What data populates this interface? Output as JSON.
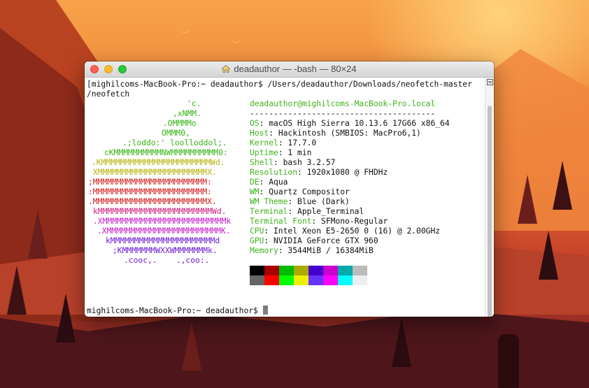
{
  "window": {
    "title": "deadauthor — -bash — 80×24"
  },
  "terminal": {
    "command_line_1": "[mighilcoms-MacBook-Pro:~ deadauthor$ /Users/deadauthor/Downloads/neofetch-master",
    "command_line_2": "/neofetch",
    "logo": [
      {
        "text": "'c.",
        "color": "#34b416"
      },
      {
        "text": ",xNMM.",
        "color": "#34b416"
      },
      {
        "text": ".OMMMMo",
        "color": "#34b416"
      },
      {
        "text": "OMMM0,",
        "color": "#34b416"
      },
      {
        "text": ".;loddo:' loolloddol;.",
        "color": "#34b416"
      },
      {
        "text": "cKMMMMMMMMMMNWMMMMMMMMMM0:",
        "color": "#34b416"
      },
      {
        "text": ".KMMMMMMMMMMMMMMMMMMMMMMMWd.",
        "color": "#b5b30c"
      },
      {
        "text": "XMMMMMMMMMMMMMMMMMMMMMMMX.",
        "color": "#b5b30c"
      },
      {
        "text": ";MMMMMMMMMMMMMMMMMMMMMMMM:",
        "color": "#d21c1c"
      },
      {
        "text": ":MMMMMMMMMMMMMMMMMMMMMMMM:",
        "color": "#d21c1c"
      },
      {
        "text": ".MMMMMMMMMMMMMMMMMMMMMMMMX.",
        "color": "#d21c1c"
      },
      {
        "text": "kMMMMMMMMMMMMMMMMMMMMMMMMWd.",
        "color": "#d21c7c"
      },
      {
        "text": ".XMMMMMMMMMMMMMMMMMMMMMMMMMMk",
        "color": "#c81ccc"
      },
      {
        "text": ".XMMMMMMMMMMMMMMMMMMMMMMMMK.",
        "color": "#c81ccc"
      },
      {
        "text": "kMMMMMMMMMMMMMMMMMMMMMMd",
        "color": "#6f1ad6"
      },
      {
        "text": ";KMMMMMMMWXXWMMMMMMMk.",
        "color": "#6f1ad6"
      },
      {
        "text": ".cooc,.    .,coo:.",
        "color": "#6f1ad6"
      }
    ],
    "user_host": "deadauthor@mighilcoms-MacBook-Pro.local",
    "separator": "---------------------------------------",
    "info": [
      {
        "label": "OS",
        "value": "macOS High Sierra 10.13.6 17G66 x86_64"
      },
      {
        "label": "Host",
        "value": "Hackintosh (SMBIOS: MacPro6,1)"
      },
      {
        "label": "Kernel",
        "value": "17.7.0"
      },
      {
        "label": "Uptime",
        "value": "1 min"
      },
      {
        "label": "Shell",
        "value": "bash 3.2.57"
      },
      {
        "label": "Resolution",
        "value": "1920x1080 @ FHDHz"
      },
      {
        "label": "DE",
        "value": "Aqua"
      },
      {
        "label": "WM",
        "value": "Quartz Compositor"
      },
      {
        "label": "WM Theme",
        "value": "Blue (Dark)"
      },
      {
        "label": "Terminal",
        "value": "Apple_Terminal"
      },
      {
        "label": "Terminal Font",
        "value": "SFMono-Regular"
      },
      {
        "label": "CPU",
        "value": "Intel Xeon E5-2650 0 (16) @ 2.00GHz"
      },
      {
        "label": "GPU",
        "value": "NVIDIA GeForce GTX 960"
      },
      {
        "label": "Memory",
        "value": "3544MiB / 16384MiB"
      }
    ],
    "palette_row1": [
      "#000000",
      "#aa0000",
      "#00bb00",
      "#aaaa00",
      "#4400cc",
      "#cc00cc",
      "#00aaaa",
      "#bbbbbb"
    ],
    "palette_row2": [
      "#666666",
      "#ff0000",
      "#00ff00",
      "#eeee00",
      "#6633ff",
      "#ff00ff",
      "#00ffff",
      "#eeeeee"
    ],
    "prompt": "mighilcoms-MacBook-Pro:~ deadauthor$"
  }
}
